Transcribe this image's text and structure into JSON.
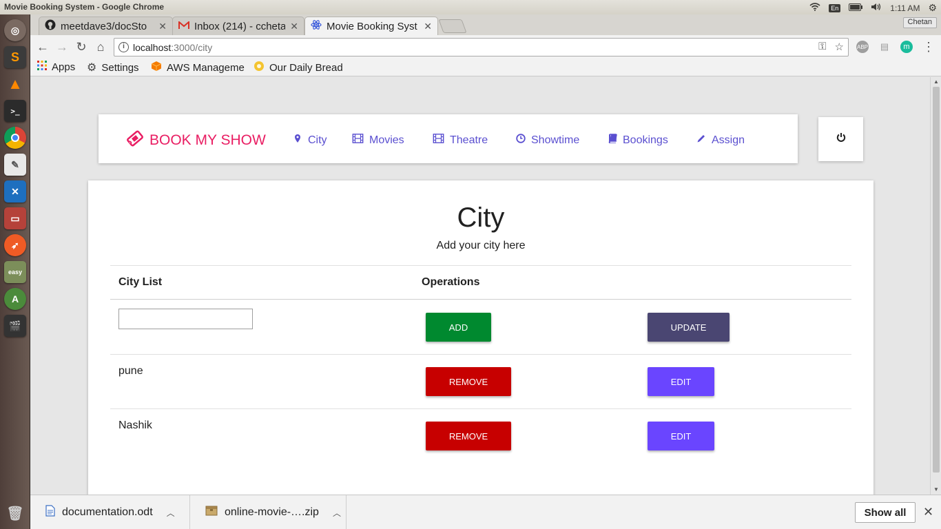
{
  "os": {
    "window_title": "Movie Booking System - Google Chrome",
    "lang": "En",
    "time": "1:11 AM"
  },
  "browser": {
    "profile": "Chetan",
    "tabs": [
      {
        "label": "meetdave3/docSto",
        "icon": "github-icon"
      },
      {
        "label": "Inbox (214) - ccheta",
        "icon": "gmail-icon"
      },
      {
        "label": "Movie Booking Syst",
        "icon": "react-icon"
      }
    ],
    "url_host": "localhost",
    "url_path": ":3000/city",
    "bookmarks": [
      {
        "label": "Apps",
        "icon": "apps-grid-icon"
      },
      {
        "label": "Settings",
        "icon": "gear-icon"
      },
      {
        "label": "AWS Manageme",
        "icon": "aws-cube-icon"
      },
      {
        "label": "Our Daily Bread",
        "icon": "bread-icon"
      }
    ],
    "ext_abp": "ABP",
    "ext_m": "m"
  },
  "app": {
    "brand": "BOOK MY SHOW",
    "brand_color": "#e91e63",
    "link_color": "#5a4fd0",
    "nav": [
      {
        "label": "City",
        "icon": "map-pin-icon"
      },
      {
        "label": "Movies",
        "icon": "film-icon"
      },
      {
        "label": "Theatre",
        "icon": "film-icon"
      },
      {
        "label": "Showtime",
        "icon": "clock-icon"
      },
      {
        "label": "Bookings",
        "icon": "book-icon"
      },
      {
        "label": "Assign",
        "icon": "pencil-icon"
      }
    ],
    "page_title": "City",
    "page_subtitle": "Add your city here",
    "table": {
      "headers": [
        "City List",
        "Operations"
      ],
      "input_value": "",
      "add_label": "ADD",
      "update_label": "UPDATE",
      "rows": [
        {
          "city": "pune",
          "remove_label": "REMOVE",
          "edit_label": "EDIT"
        },
        {
          "city": "Nashik",
          "remove_label": "REMOVE",
          "edit_label": "EDIT"
        }
      ],
      "colors": {
        "add": "#00892f",
        "update": "#4a4672",
        "remove": "#c70000",
        "edit": "#6a45ff"
      }
    }
  },
  "downloads": {
    "items": [
      {
        "name": "documentation.odt",
        "icon": "document-icon"
      },
      {
        "name": "online-movie-….zip",
        "icon": "archive-icon"
      }
    ],
    "show_all": "Show all"
  }
}
